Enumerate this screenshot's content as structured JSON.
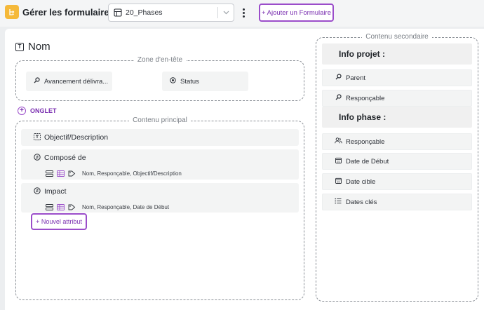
{
  "header": {
    "title": "Gérer les formulaires",
    "form_select": {
      "value": "20_Phases"
    },
    "add_form_label": "+ Ajouter un Formulaire"
  },
  "form": {
    "name_label": "Nom",
    "header_zone": {
      "legend": "Zone d'en-tête",
      "chips": [
        {
          "label": "Avancement délivra...",
          "icon": "search-icon"
        },
        {
          "label": "Status",
          "icon": "target-icon"
        }
      ]
    },
    "onglet_label": "ONGLET",
    "main_content": {
      "legend": "Contenu principal",
      "attributes": [
        {
          "label": "Objectif/Description",
          "icon": "text-field-icon",
          "sub": ""
        },
        {
          "label": "Composé de",
          "icon": "relation-icon",
          "sub": "Nom, Responçable, Objectif/Description"
        },
        {
          "label": "Impact",
          "icon": "relation-icon",
          "sub": "Nom, Responçable, Date de Début"
        }
      ],
      "new_attr_label": "+ Nouvel attribut"
    },
    "secondary": {
      "legend": "Contenu secondaire",
      "sections": [
        {
          "title": "Info projet :",
          "items": [
            {
              "label": "Parent",
              "icon": "search-icon"
            },
            {
              "label": "Responçable",
              "icon": "search-icon"
            }
          ]
        },
        {
          "title": "Info phase :",
          "items": [
            {
              "label": "Responçable",
              "icon": "users-icon"
            },
            {
              "label": "Date de Début",
              "icon": "calendar-icon"
            },
            {
              "label": "Date cible",
              "icon": "calendar-icon"
            },
            {
              "label": "Dates clés",
              "icon": "list-icon"
            }
          ]
        }
      ]
    }
  },
  "colors": {
    "accent": "#9b4dca",
    "app_icon": "#f5b93a"
  }
}
